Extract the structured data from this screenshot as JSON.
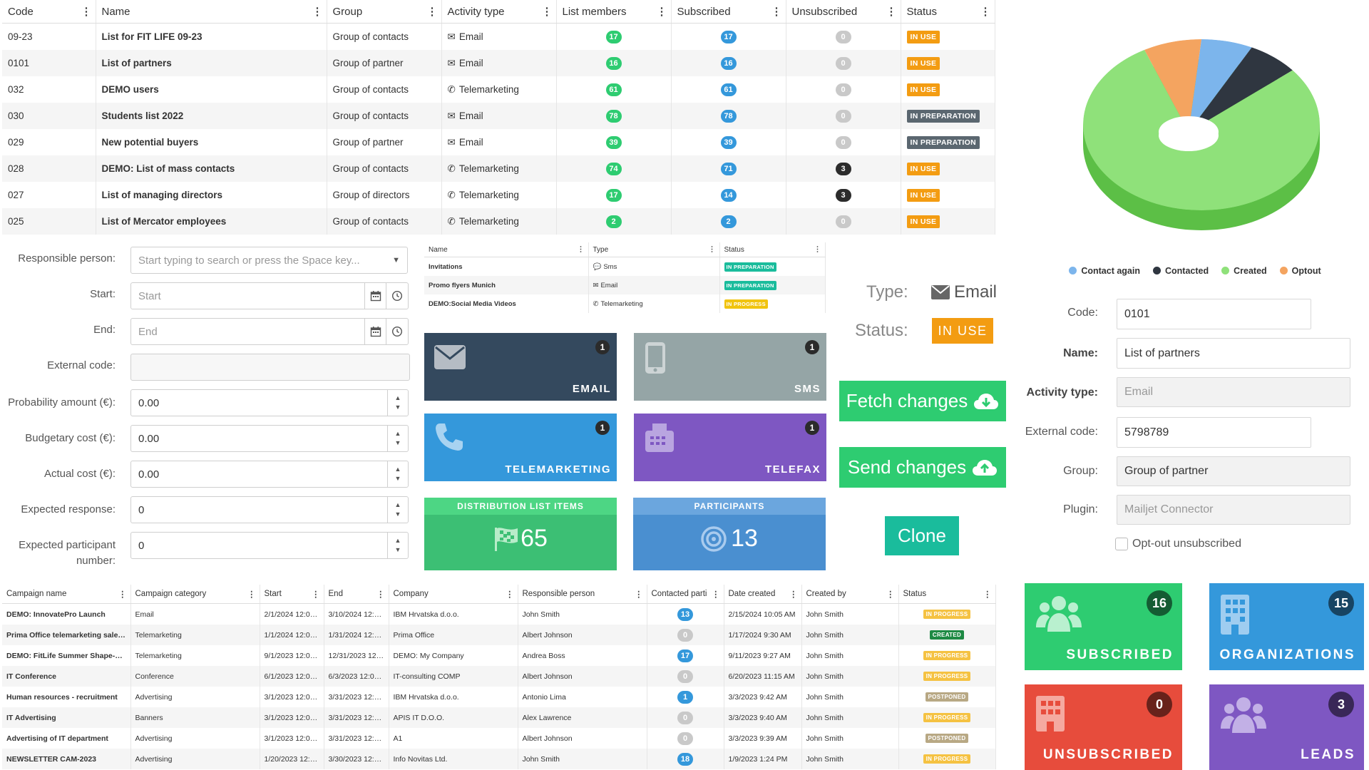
{
  "lists_table": {
    "columns": [
      "Code",
      "Name",
      "Group",
      "Activity type",
      "List members",
      "Subscribed",
      "Unsubscribed",
      "Status"
    ],
    "rows": [
      {
        "code": "09-23",
        "name": "List for FIT LIFE 09-23",
        "group": "Group of contacts",
        "activity": "Email",
        "activity_icon": "envelope-icon",
        "members": "17",
        "subscribed": "17",
        "unsubscribed": "0",
        "status": "IN USE"
      },
      {
        "code": "0101",
        "name": "List of partners",
        "group": "Group of partner",
        "activity": "Email",
        "activity_icon": "envelope-icon",
        "members": "16",
        "subscribed": "16",
        "unsubscribed": "0",
        "status": "IN USE"
      },
      {
        "code": "032",
        "name": "DEMO users",
        "group": "Group of contacts",
        "activity": "Telemarketing",
        "activity_icon": "phone-icon",
        "members": "61",
        "subscribed": "61",
        "unsubscribed": "0",
        "status": "IN USE"
      },
      {
        "code": "030",
        "name": "Students list 2022",
        "group": "Group of contacts",
        "activity": "Email",
        "activity_icon": "envelope-icon",
        "members": "78",
        "subscribed": "78",
        "unsubscribed": "0",
        "status": "IN PREPARATION"
      },
      {
        "code": "029",
        "name": "New potential buyers",
        "group": "Group of partner",
        "activity": "Email",
        "activity_icon": "envelope-icon",
        "members": "39",
        "subscribed": "39",
        "unsubscribed": "0",
        "status": "IN PREPARATION"
      },
      {
        "code": "028",
        "name": "DEMO: List of mass contacts",
        "group": "Group of contacts",
        "activity": "Telemarketing",
        "activity_icon": "phone-icon",
        "members": "74",
        "subscribed": "71",
        "unsubscribed": "3",
        "status": "IN USE"
      },
      {
        "code": "027",
        "name": "List of managing directors",
        "group": "Group of directors",
        "activity": "Telemarketing",
        "activity_icon": "phone-icon",
        "members": "17",
        "subscribed": "14",
        "unsubscribed": "3",
        "status": "IN USE"
      },
      {
        "code": "025",
        "name": "List of Mercator employees",
        "group": "Group of contacts",
        "activity": "Telemarketing",
        "activity_icon": "phone-icon",
        "members": "2",
        "subscribed": "2",
        "unsubscribed": "0",
        "status": "IN USE"
      }
    ]
  },
  "pie": {
    "legend": [
      "Contact again",
      "Contacted",
      "Created",
      "Optout"
    ],
    "colors": {
      "Contact again": "#7cb5ec",
      "Contacted": "#2f3640",
      "Created": "#8fe17a",
      "Optout": "#f4a460"
    },
    "fractions": [
      0.07,
      0.07,
      0.78,
      0.08
    ]
  },
  "form": {
    "responsible_label": "Responsible person:",
    "responsible_placeholder": "Start typing to search or press the Space key...",
    "start_label": "Start:",
    "start_placeholder": "Start",
    "end_label": "End:",
    "end_placeholder": "End",
    "external_code_label": "External code:",
    "probability_label": "Probability amount (€):",
    "probability_value": "0.00",
    "budgetary_label": "Budgetary cost (€):",
    "budgetary_value": "0.00",
    "actual_label": "Actual cost (€):",
    "actual_value": "0.00",
    "expected_response_label": "Expected response:",
    "expected_response_value": "0",
    "expected_participant_label": "Expected participant number:",
    "expected_participant_value": "0"
  },
  "mini_table": {
    "columns": [
      "Name",
      "Type",
      "Status"
    ],
    "rows": [
      {
        "name": "Invitations",
        "type": "Sms",
        "type_icon": "chat-icon",
        "status": "IN PREPARATION"
      },
      {
        "name": "Promo flyers Munich",
        "type": "Email",
        "type_icon": "envelope-icon",
        "status": "IN PREPARATION"
      },
      {
        "name": "DEMO:Social Media Videos",
        "type": "Telemarketing",
        "type_icon": "phone-icon",
        "status": "IN PROGRESS"
      }
    ]
  },
  "channel_tiles": {
    "email": {
      "label": "EMAIL",
      "count": "1"
    },
    "sms": {
      "label": "SMS",
      "count": "1"
    },
    "telemarketing": {
      "label": "TELEMARKETING",
      "count": "1"
    },
    "telefax": {
      "label": "TELEFAX",
      "count": "1"
    }
  },
  "distribution": {
    "label": "DISTRIBUTION LIST ITEMS",
    "value": "65"
  },
  "participants": {
    "label": "PARTICIPANTS",
    "value": "13"
  },
  "type_status": {
    "type_label": "Type:",
    "type_value": "Email",
    "status_label": "Status:",
    "status_value": "IN USE"
  },
  "buttons": {
    "fetch": "Fetch changes",
    "send": "Send changes",
    "clone": "Clone"
  },
  "right_form": {
    "code_label": "Code:",
    "code_value": "0101",
    "name_label": "Name:",
    "name_value": "List of partners",
    "activity_label": "Activity type:",
    "activity_value": "Email",
    "external_label": "External code:",
    "external_value": "5798789",
    "group_label": "Group:",
    "group_value": "Group of partner",
    "plugin_label": "Plugin:",
    "plugin_value": "Mailjet Connector",
    "optout_label": "Opt-out unsubscribed"
  },
  "campaigns_table": {
    "columns": [
      "Campaign name",
      "Campaign category",
      "Start",
      "End",
      "Company",
      "Responsible person",
      "Contacted parti",
      "Date created",
      "Created by",
      "Status"
    ],
    "rows": [
      {
        "name": "DEMO: InnovatePro Launch",
        "category": "Email",
        "start": "2/1/2024 12:00...",
        "end": "3/10/2024 12:0...",
        "company": "IBM Hrvatska d.o.o.",
        "person": "John Smith",
        "contacted": "13",
        "created": "2/15/2024 10:05 AM",
        "by": "John Smith",
        "status": "IN PROGRESS"
      },
      {
        "name": "Prima Office telemarketing sales ...",
        "category": "Telemarketing",
        "start": "1/1/2024 12:00...",
        "end": "1/31/2024 12:0...",
        "company": "Prima Office",
        "person": "Albert Johnson",
        "contacted": "0",
        "created": "1/17/2024 9:30 AM",
        "by": "John Smith",
        "status": "CREATED"
      },
      {
        "name": "DEMO: FitLife Summer Shape-Up...",
        "category": "Telemarketing",
        "start": "9/1/2023 12:00...",
        "end": "12/31/2023 12:...",
        "company": "DEMO: My Company",
        "person": "Andrea Boss",
        "contacted": "17",
        "created": "9/11/2023 9:27 AM",
        "by": "John Smith",
        "status": "IN PROGRESS"
      },
      {
        "name": "IT Conference",
        "category": "Conference",
        "start": "6/1/2023 12:00...",
        "end": "6/3/2023 12:00...",
        "company": "IT-consulting COMP",
        "person": "Albert Johnson",
        "contacted": "0",
        "created": "6/20/2023 11:15 AM",
        "by": "John Smith",
        "status": "IN PROGRESS"
      },
      {
        "name": "Human resources - recruitment",
        "category": "Advertising",
        "start": "3/1/2023 12:00...",
        "end": "3/31/2023 12:0...",
        "company": "IBM Hrvatska d.o.o.",
        "person": "Antonio Lima",
        "contacted": "1",
        "created": "3/3/2023 9:42 AM",
        "by": "John Smith",
        "status": "POSTPONED"
      },
      {
        "name": "IT Advertising",
        "category": "Banners",
        "start": "3/1/2023 12:00...",
        "end": "3/31/2023 12:0...",
        "company": "APIS IT D.O.O.",
        "person": "Alex Lawrence",
        "contacted": "0",
        "created": "3/3/2023 9:40 AM",
        "by": "John Smith",
        "status": "IN PROGRESS"
      },
      {
        "name": "Advertising of IT department",
        "category": "Advertising",
        "start": "3/1/2023 12:00...",
        "end": "3/31/2023 12:0...",
        "company": "A1",
        "person": "Albert Johnson",
        "contacted": "0",
        "created": "3/3/2023 9:39 AM",
        "by": "John Smith",
        "status": "POSTPONED"
      },
      {
        "name": "NEWSLETTER CAM-2023",
        "category": "Advertising",
        "start": "1/20/2023 12:0...",
        "end": "3/30/2023 12:0...",
        "company": "Info Novitas Ltd.",
        "person": "John Smith",
        "contacted": "18",
        "created": "1/9/2023 1:24 PM",
        "by": "John Smith",
        "status": "IN PROGRESS"
      }
    ]
  },
  "stats": {
    "subscribed": {
      "label": "SUBSCRIBED",
      "value": "16"
    },
    "organizations": {
      "label": "ORGANIZATIONS",
      "value": "15"
    },
    "unsubscribed": {
      "label": "UNSUBSCRIBED",
      "value": "0"
    },
    "leads": {
      "label": "LEADS",
      "value": "3"
    }
  }
}
